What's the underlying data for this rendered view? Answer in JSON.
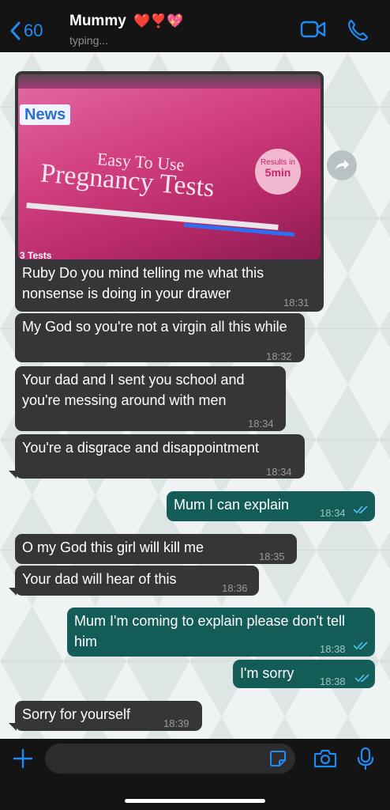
{
  "header": {
    "back_count": "60",
    "contact_name": "Mummy",
    "contact_emojis": "❤️❣️💖",
    "status": "typing..."
  },
  "photo": {
    "news_label": "News",
    "line1": "Easy To Use",
    "line2": "Pregnancy Tests",
    "badge_top": "Results in",
    "badge_bottom": "5min",
    "count": "3 Tests",
    "accent": "#d13c86"
  },
  "messages": [
    {
      "text": "Ruby Do you mind telling me what this nonsense is doing in your drawer",
      "time": "18:31"
    },
    {
      "text": "My God so you're not a virgin all this while",
      "time": "18:32"
    },
    {
      "text": "Your dad and I sent you school and you're messing around with men",
      "time": "18:34"
    },
    {
      "text": "You're a disgrace and disappointment",
      "time": "18:34"
    },
    {
      "text": "Mum I can explain",
      "time": "18:34"
    },
    {
      "text": "O my God this girl will kill me",
      "time": "18:35"
    },
    {
      "text": "Your dad will hear of this",
      "time": "18:36"
    },
    {
      "text": "Mum I'm coming to explain please don't tell him",
      "time": "18:38"
    },
    {
      "text": "I'm sorry",
      "time": "18:38"
    },
    {
      "text": "Sorry for yourself",
      "time": "18:39"
    }
  ],
  "colors": {
    "incoming_bubble": "#363638",
    "outgoing_bubble": "#145c57",
    "accent_blue": "#1f8cf5",
    "read_tick": "#53bdeb"
  },
  "icons": [
    "back-chevron-icon",
    "video-call-icon",
    "phone-icon",
    "forward-icon",
    "plus-icon",
    "sticker-icon",
    "camera-icon",
    "microphone-icon",
    "double-tick-icon"
  ]
}
